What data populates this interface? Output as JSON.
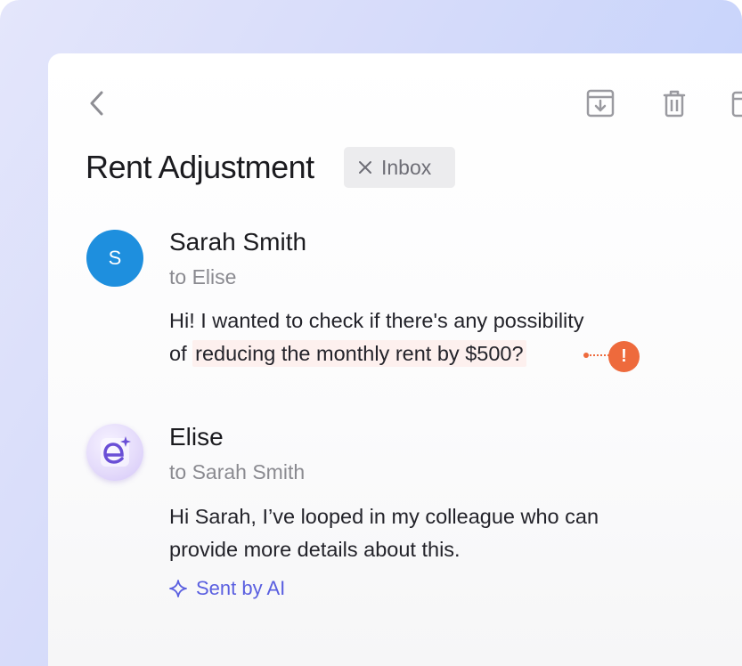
{
  "thread": {
    "subject": "Rent Adjustment",
    "label": "Inbox"
  },
  "messages": [
    {
      "avatar_letter": "S",
      "sender": "Sarah Smith",
      "recipient": "to Elise",
      "body_line1": "Hi! I wanted to check if there's any possibility",
      "body_line2_prefix": "of ",
      "body_line2_highlight": "reducing the monthly rent by $500?"
    },
    {
      "sender": "Elise",
      "recipient": "to Sarah Smith",
      "body_line1": "Hi Sarah, I’ve looped in my colleague who can",
      "body_line2": "provide more details about this.",
      "ai_tag": "Sent by AI"
    }
  ],
  "icons": {
    "back": "chevron-left-icon",
    "archive": "archive-icon",
    "delete": "trash-icon",
    "more": "move-icon",
    "remove_label": "close-icon",
    "flag": "exclamation-icon",
    "ai": "sparkle-icon"
  },
  "colors": {
    "avatar_sarah": "#1e8fde",
    "flag": "#ee6a3c",
    "ai_accent": "#5a5fe0",
    "highlight": "#fdf0ee"
  }
}
